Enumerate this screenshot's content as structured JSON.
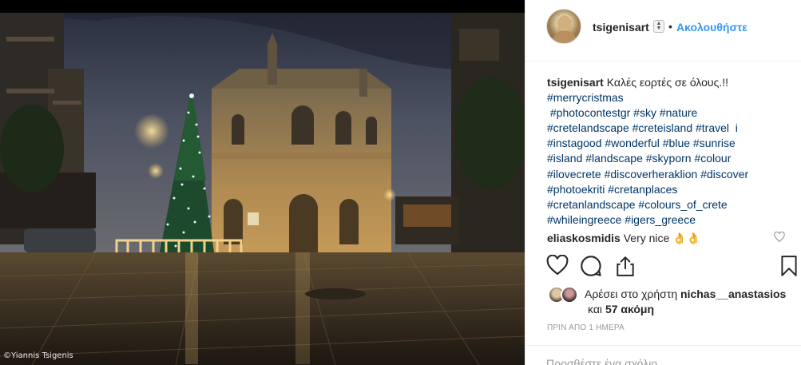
{
  "photo": {
    "credit": "©Yiannis Tsigenis"
  },
  "header": {
    "username": "tsigenisart",
    "separator": "•",
    "follow_label": "Ακολουθήστε"
  },
  "caption": {
    "username": "tsigenisart",
    "text": "Καλές εορτές σε όλους.!!",
    "lines": [
      "#merrycristmas",
      " #photocontestgr #sky #nature",
      "#cretelandscape #creteisland #travel  i",
      "#instagood #wonderful #blue #sunrise",
      "#island #landscape #skyporn #colour",
      "#ilovecrete #discoverheraklion #discover",
      "#photoekriti #cretanplaces",
      "#cretanlandscape #colours_of_crete",
      "#whileingreece #igers_greece"
    ]
  },
  "comment": {
    "username": "eliaskosmidis",
    "text": "Very nice 👌👌"
  },
  "likes": {
    "prefix": "Αρέσει στο χρήστη",
    "user": "nichas__anastasios",
    "suffix_and": "και",
    "count_text": "57 ακόμη"
  },
  "time_ago": "ΠΡΙΝ ΑΠΟ 1 ΗΜΕΡΑ",
  "add_comment": {
    "placeholder": "Προσθέστε ένα σχόλιο..."
  },
  "icons": {
    "like": "heart-icon",
    "comment": "comment-icon",
    "share": "share-icon",
    "save": "bookmark-icon"
  },
  "colors": {
    "follow": "#3897f0",
    "hashtag": "#003569",
    "muted": "#999999"
  }
}
